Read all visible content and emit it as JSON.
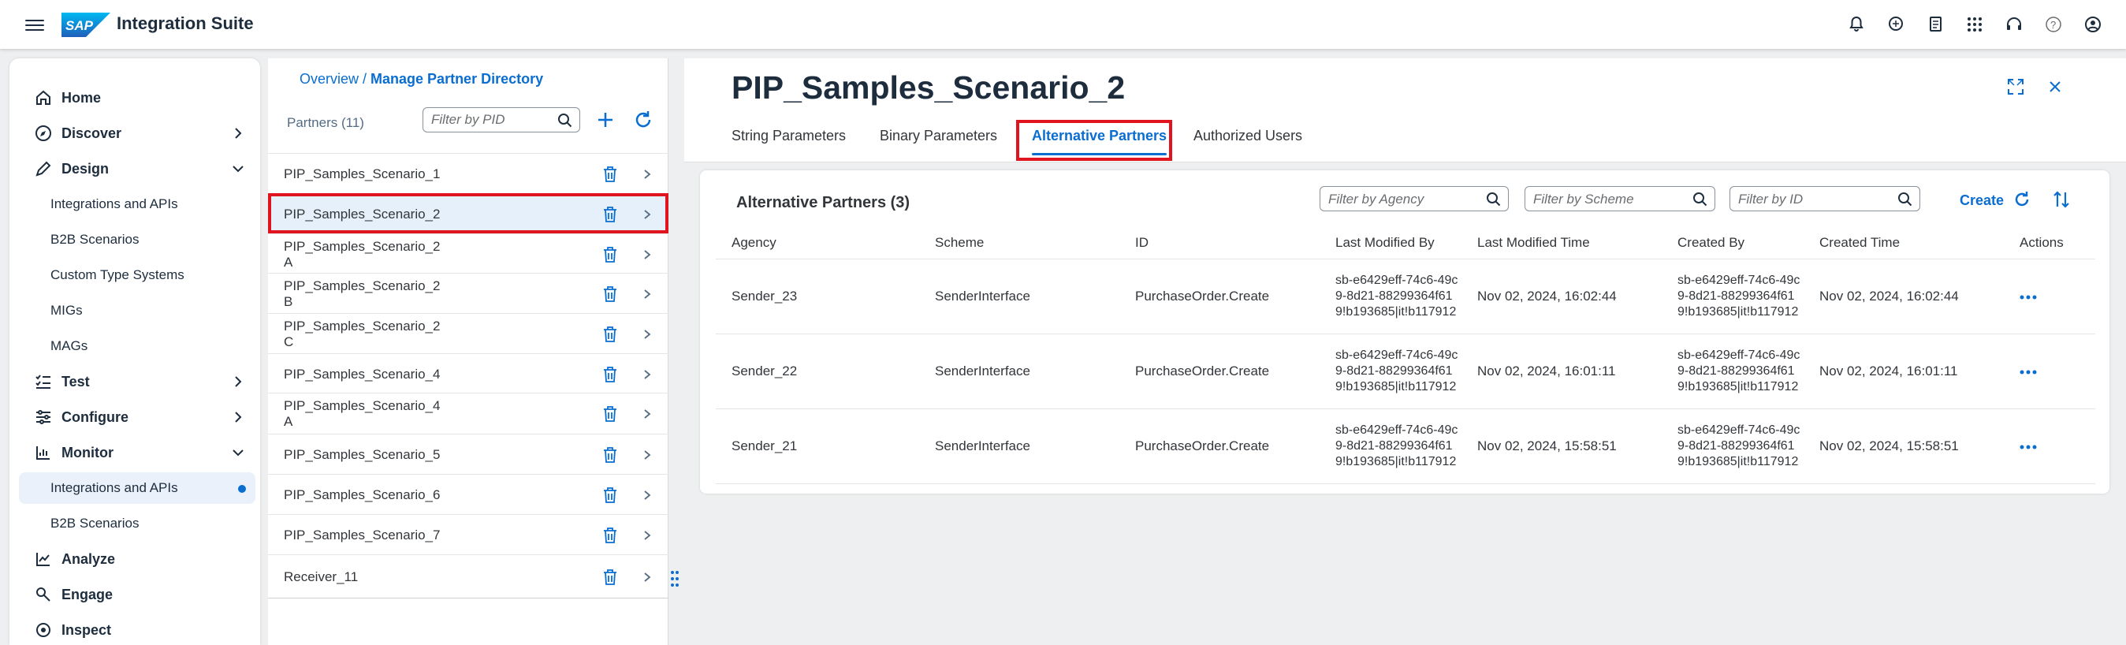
{
  "shell": {
    "brand": "Integration Suite",
    "logo_text": "SAP"
  },
  "nav": {
    "items": [
      {
        "label": "Home",
        "icon": "home-icon"
      },
      {
        "label": "Discover",
        "icon": "compass-icon"
      },
      {
        "label": "Design",
        "icon": "pencil-icon"
      },
      {
        "label": "Integrations and APIs"
      },
      {
        "label": "B2B Scenarios"
      },
      {
        "label": "Custom Type Systems"
      },
      {
        "label": "MIGs"
      },
      {
        "label": "MAGs"
      },
      {
        "label": "Test",
        "icon": "checklist-icon"
      },
      {
        "label": "Configure",
        "icon": "sliders-icon"
      },
      {
        "label": "Monitor",
        "icon": "chart-icon"
      },
      {
        "label": "Integrations and APIs"
      },
      {
        "label": "B2B Scenarios"
      },
      {
        "label": "Analyze",
        "icon": "analyze-icon"
      },
      {
        "label": "Engage",
        "icon": "engage-icon"
      },
      {
        "label": "Inspect",
        "icon": "inspect-icon"
      }
    ]
  },
  "list": {
    "breadcrumb_link": "Overview",
    "breadcrumb_sep": " / ",
    "breadcrumb_current": "Manage Partner Directory",
    "title": "Partners (11)",
    "filter_placeholder": "Filter by PID",
    "partners": [
      {
        "l1": "PIP_Samples_Scenario_1",
        "l2": ""
      },
      {
        "l1": "PIP_Samples_Scenario_2",
        "l2": ""
      },
      {
        "l1": "PIP_Samples_Scenario_2",
        "l2": "A"
      },
      {
        "l1": "PIP_Samples_Scenario_2",
        "l2": "B"
      },
      {
        "l1": "PIP_Samples_Scenario_2",
        "l2": "C"
      },
      {
        "l1": "PIP_Samples_Scenario_4",
        "l2": ""
      },
      {
        "l1": "PIP_Samples_Scenario_4",
        "l2": "A"
      },
      {
        "l1": "PIP_Samples_Scenario_5",
        "l2": ""
      },
      {
        "l1": "PIP_Samples_Scenario_6",
        "l2": ""
      },
      {
        "l1": "PIP_Samples_Scenario_7",
        "l2": ""
      },
      {
        "l1": "Receiver_11",
        "l2": ""
      }
    ]
  },
  "detail": {
    "title": "PIP_Samples_Scenario_2",
    "tabs": [
      "String Parameters",
      "Binary Parameters",
      "Alternative Partners",
      "Authorized Users"
    ],
    "card_title": "Alternative Partners (3)",
    "filters": [
      "Filter by Agency",
      "Filter by Scheme",
      "Filter by ID"
    ],
    "create": "Create",
    "columns": [
      "Agency",
      "Scheme",
      "ID",
      "Last Modified By",
      "Last Modified Time",
      "Created By",
      "Created Time",
      "Actions"
    ],
    "rows": [
      {
        "agency": "Sender_23",
        "scheme": "SenderInterface",
        "id": "PurchaseOrder.Create",
        "mod_by": "sb-e6429eff-74c6-49c9-8d21-88299364f619!b193685|it!b117912",
        "mod_time": "Nov 02, 2024, 16:02:44",
        "cr_by": "sb-e6429eff-74c6-49c9-8d21-88299364f619!b193685|it!b117912",
        "cr_time": "Nov 02, 2024, 16:02:44"
      },
      {
        "agency": "Sender_22",
        "scheme": "SenderInterface",
        "id": "PurchaseOrder.Create",
        "mod_by": "sb-e6429eff-74c6-49c9-8d21-88299364f619!b193685|it!b117912",
        "mod_time": "Nov 02, 2024, 16:01:11",
        "cr_by": "sb-e6429eff-74c6-49c9-8d21-88299364f619!b193685|it!b117912",
        "cr_time": "Nov 02, 2024, 16:01:11"
      },
      {
        "agency": "Sender_21",
        "scheme": "SenderInterface",
        "id": "PurchaseOrder.Create",
        "mod_by": "sb-e6429eff-74c6-49c9-8d21-88299364f619!b193685|it!b117912",
        "mod_time": "Nov 02, 2024, 15:58:51",
        "cr_by": "sb-e6429eff-74c6-49c9-8d21-88299364f619!b193685|it!b117912",
        "cr_time": "Nov 02, 2024, 15:58:51"
      }
    ]
  },
  "colors": {
    "accent": "#0a6ed1",
    "highlight": "#e0141e",
    "selected_row": "#e5f0fa"
  }
}
